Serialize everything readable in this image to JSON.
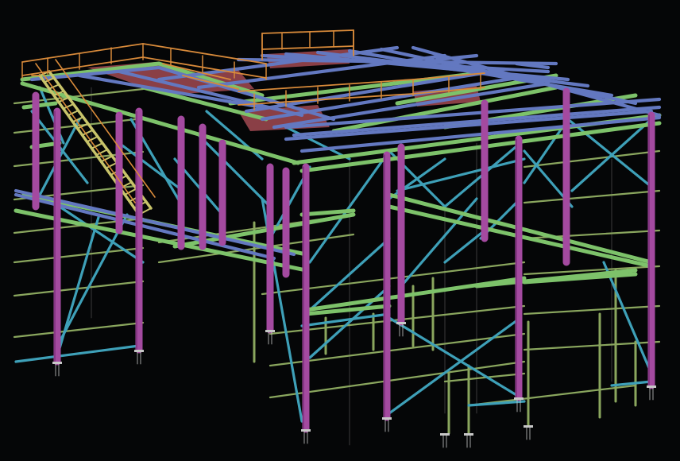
{
  "palette": {
    "background": "#050607",
    "column": "#a44aa0",
    "column_edge": "#7c2f7b",
    "beam": "#7dc26a",
    "beam_edge": "#5b9a4b",
    "joist": "#6378c0",
    "joist_edge": "#4a5b96",
    "brace": "#3ea0b8",
    "secondary": "#8aa65e",
    "handrail": "#d88a3a",
    "deck": "#8a3f46",
    "stair": "#c8c46a",
    "base_plate": "#c8c8c8",
    "hidden_line": "#606060"
  },
  "member_types": [
    "column",
    "beam",
    "joist",
    "brace",
    "secondary",
    "handrail",
    "deck",
    "stair",
    "base_plate"
  ]
}
